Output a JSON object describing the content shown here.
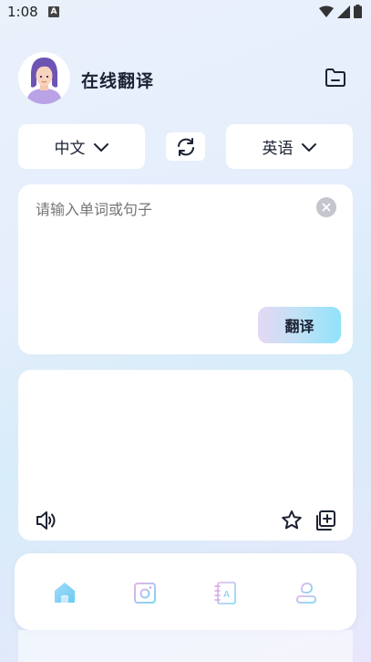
{
  "status_bar": {
    "time": "1:08",
    "notification_badge": "A"
  },
  "header": {
    "title": "在线翻译",
    "avatar_icon": "avatar-girl",
    "folder_icon": "folder-icon"
  },
  "languages": {
    "source": "中文",
    "target": "英语",
    "swap_icon": "swap-icon"
  },
  "input": {
    "placeholder": "请输入单词或句子",
    "value": "",
    "translate_label": "翻译"
  },
  "output": {
    "text": ""
  },
  "bottom_nav": {
    "items": [
      {
        "id": "home",
        "icon": "home-icon",
        "active": true
      },
      {
        "id": "camera",
        "icon": "camera-icon",
        "active": false
      },
      {
        "id": "dictionary",
        "icon": "dictionary-icon",
        "active": false
      },
      {
        "id": "profile",
        "icon": "profile-icon",
        "active": false
      }
    ]
  },
  "colors": {
    "accent_start": "#e5d8f4",
    "accent_end": "#8fe3fb",
    "text_primary": "#1c2233",
    "placeholder": "#8c9097"
  }
}
